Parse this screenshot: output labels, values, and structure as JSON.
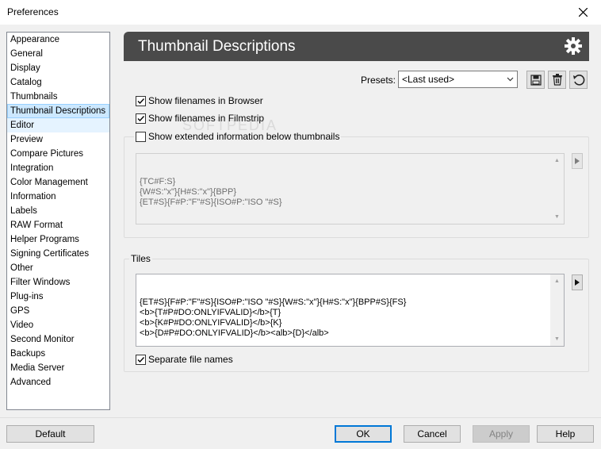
{
  "window": {
    "title": "Preferences"
  },
  "sidebar": {
    "items": [
      {
        "label": "Appearance"
      },
      {
        "label": "General"
      },
      {
        "label": "Display"
      },
      {
        "label": "Catalog"
      },
      {
        "label": "Thumbnails"
      },
      {
        "label": "Thumbnail Descriptions",
        "selected": true
      },
      {
        "label": "Editor"
      },
      {
        "label": "Preview"
      },
      {
        "label": "Compare Pictures"
      },
      {
        "label": "Integration"
      },
      {
        "label": "Color Management"
      },
      {
        "label": "Information"
      },
      {
        "label": "Labels"
      },
      {
        "label": "RAW Format"
      },
      {
        "label": "Helper Programs"
      },
      {
        "label": "Signing Certificates"
      },
      {
        "label": "Other"
      },
      {
        "label": "Filter Windows"
      },
      {
        "label": "Plug-ins"
      },
      {
        "label": "GPS"
      },
      {
        "label": "Video"
      },
      {
        "label": "Second Monitor"
      },
      {
        "label": "Backups"
      },
      {
        "label": "Media Server"
      },
      {
        "label": "Advanced"
      }
    ]
  },
  "header": {
    "title": "Thumbnail Descriptions"
  },
  "presets": {
    "label": "Presets:",
    "value": "<Last used>"
  },
  "options": {
    "show_in_browser": {
      "label": "Show filenames in Browser",
      "checked": true
    },
    "show_in_filmstrip": {
      "label": "Show filenames in Filmstrip",
      "checked": true
    },
    "show_extended": {
      "label": "Show extended information below thumbnails",
      "checked": false
    }
  },
  "extended_text": {
    "lines": [
      "{TC#F:S}",
      "{W#S:\"x\"}{H#S:\"x\"}{BPP}",
      "{ET#S}{F#P:\"F\"#S}{ISO#P:\"ISO \"#S}"
    ]
  },
  "tiles": {
    "label": "Tiles",
    "lines": [
      "{ET#S}{F#P:\"F\"#S}{ISO#P:\"ISO \"#S}{W#S:\"x\"}{H#S:\"x\"}{BPP#S}{FS}",
      "<b>{T#P#DO:ONLYIFVALID}</b>{T}",
      "<b>{K#P#DO:ONLYIFVALID}</b>{K}",
      "<b>{D#P#DO:ONLYIFVALID}</b><alb>{D}</alb>"
    ],
    "separate": {
      "label": "Separate file names",
      "checked": true
    }
  },
  "buttons": {
    "default": "Default",
    "ok": "OK",
    "cancel": "Cancel",
    "apply": "Apply",
    "help": "Help"
  },
  "watermark": "SOFTPEDIA",
  "icons": {
    "close": "close-icon",
    "gear": "gear-icon",
    "save": "save-icon",
    "delete": "trash-icon",
    "reset": "undo-icon"
  },
  "colors": {
    "header_bg": "#4a4a4a",
    "selection_bg": "#cce8ff",
    "default_button_border": "#0078d7"
  }
}
